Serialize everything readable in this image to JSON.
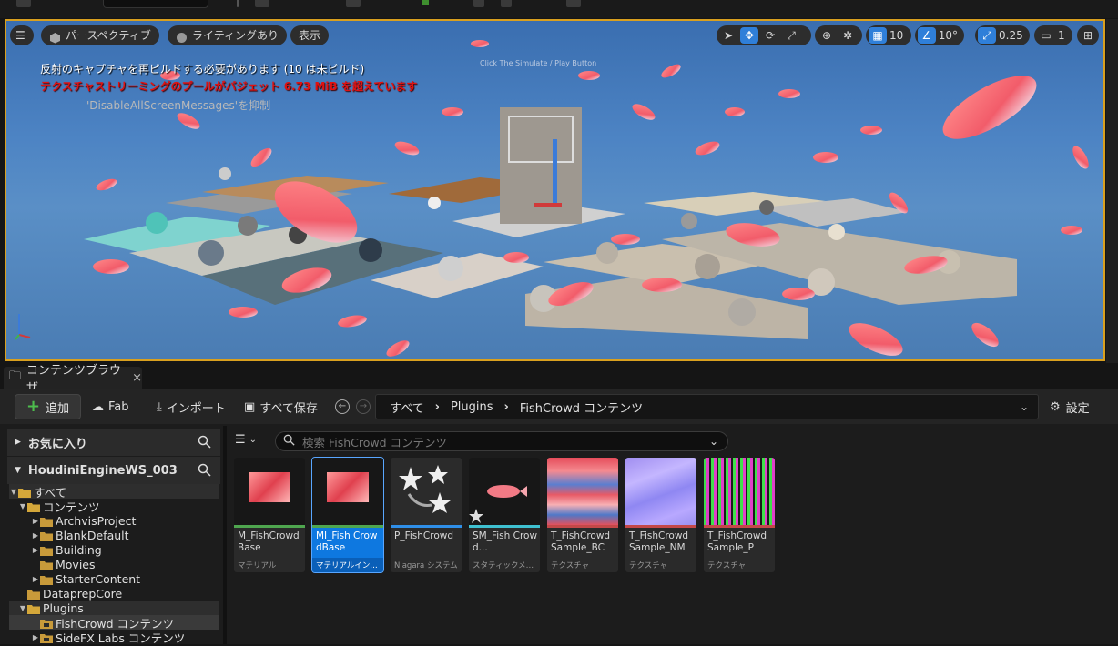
{
  "viewport": {
    "menu_label": "",
    "perspective_label": "パースペクティブ",
    "lighting_label": "ライティングあり",
    "show_label": "表示",
    "grid_value": "10",
    "rotation_value": "10°",
    "scale_value": "0.25",
    "camera_value": "1",
    "messages": [
      "反射のキャプチャを再ビルドする必要があります (10 は未ビルド)",
      "テクスチャストリーミングのプールがバジェット 6.73 MiB を超えています",
      "'DisableAllScreenMessages'を抑制"
    ],
    "scene_caption": "Click The Simulate / Play Button"
  },
  "content_browser": {
    "tab_title": "コンテンツブラウザ",
    "toolbar": {
      "add_label": "追加",
      "fab_label": "Fab",
      "import_label": "インポート",
      "save_all_label": "すべて保存",
      "settings_label": "設定"
    },
    "breadcrumb": [
      "すべて",
      "Plugins",
      "FishCrowd コンテンツ"
    ],
    "favorites_label": "お気に入り",
    "project_label": "HoudiniEngineWS_003",
    "tree": [
      {
        "label": "すべて",
        "depth": 0,
        "expanded": true
      },
      {
        "label": "コンテンツ",
        "depth": 1,
        "expanded": true
      },
      {
        "label": "ArchvisProject",
        "depth": 2,
        "expanded": false
      },
      {
        "label": "BlankDefault",
        "depth": 2,
        "expanded": false
      },
      {
        "label": "Building",
        "depth": 2,
        "expanded": false
      },
      {
        "label": "Movies",
        "depth": 2,
        "expanded": null
      },
      {
        "label": "StarterContent",
        "depth": 2,
        "expanded": false
      },
      {
        "label": "DataprepCore",
        "depth": 1,
        "expanded": null
      },
      {
        "label": "Plugins",
        "depth": 1,
        "expanded": true
      },
      {
        "label": "FishCrowd コンテンツ",
        "depth": 2,
        "expanded": null
      },
      {
        "label": "SideFX Labs コンテンツ",
        "depth": 2,
        "expanded": false
      }
    ],
    "search_placeholder": "検索 FishCrowd コンテンツ",
    "assets": [
      {
        "name": "M_FishCrowdBase",
        "display": "M_FishCrowd Base",
        "type": "マテリアル",
        "color": "#4fa64f"
      },
      {
        "name": "MI_FishCrowdBase",
        "display": "MI_Fish CrowdBase",
        "type": "マテリアルインス...",
        "color": "#4fa64f"
      },
      {
        "name": "P_FishCrowd",
        "display": "P_FishCrowd",
        "type": "Niagara システム",
        "color": "#2f8fe8"
      },
      {
        "name": "SM_FishCrowd",
        "display": "SM_Fish Crowd...",
        "type": "スタティックメッ...",
        "color": "#3fc1d1"
      },
      {
        "name": "T_FishCrowdSample_BC",
        "display": "T_FishCrowd Sample_BC",
        "type": "テクスチャ",
        "color": "#c44848"
      },
      {
        "name": "T_FishCrowdSample_NM",
        "display": "T_FishCrowd Sample_NM",
        "type": "テクスチャ",
        "color": "#c44848"
      },
      {
        "name": "T_FishCrowdSample_P",
        "display": "T_FishCrowd Sample_P",
        "type": "テクスチャ",
        "color": "#c44848"
      }
    ]
  }
}
